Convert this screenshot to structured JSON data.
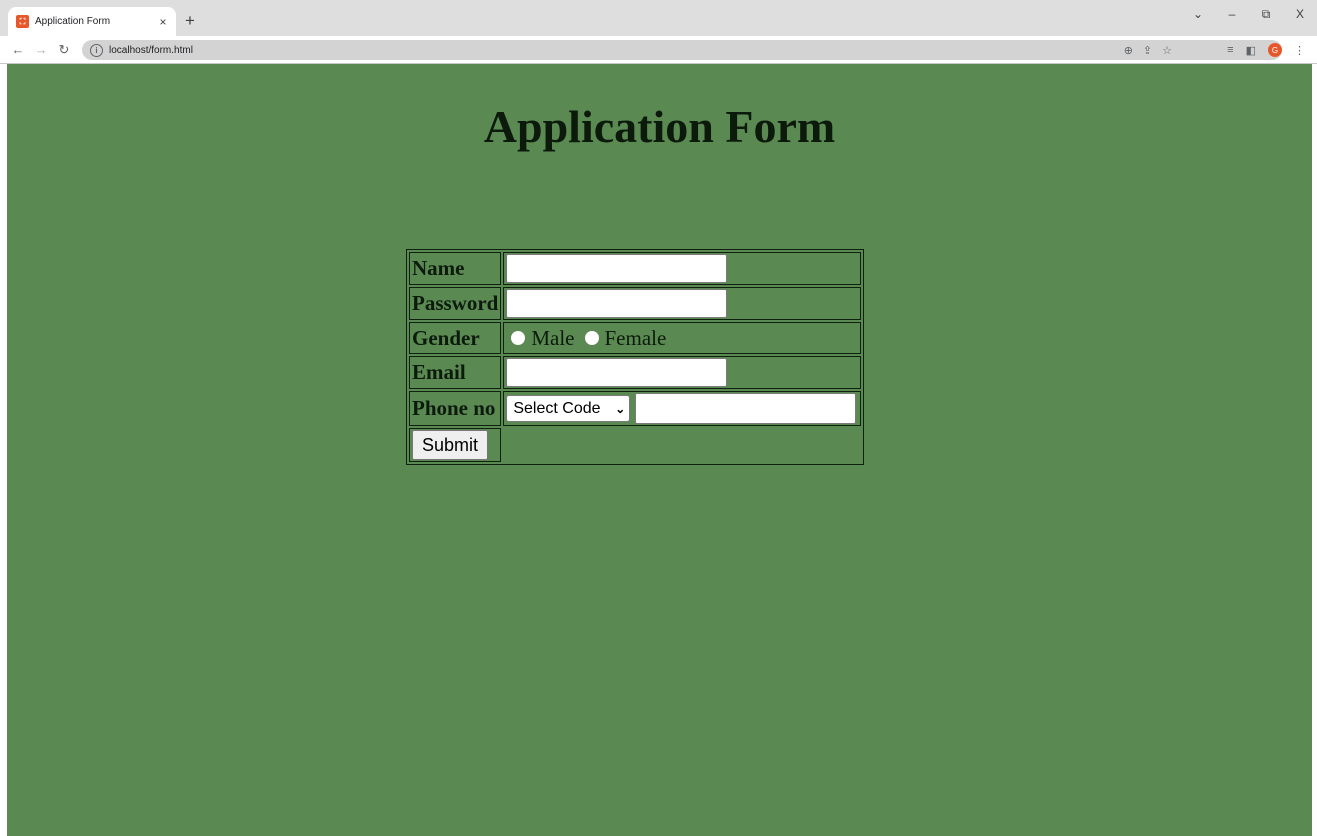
{
  "browser": {
    "tab_title": "Application Form",
    "tab_close": "×",
    "new_tab": "+",
    "url": "localhost/form.html",
    "profile_initial": "G",
    "window_controls": {
      "dropdown": "⌄",
      "minimize": "–",
      "restore": "⧉",
      "close": "X"
    }
  },
  "page": {
    "title": "Application Form",
    "background_color": "#5a8a52"
  },
  "form": {
    "name_label": "Name",
    "password_label": "Password",
    "gender_label": "Gender",
    "gender_options": [
      "Male",
      "Female"
    ],
    "email_label": "Email",
    "phone_label": "Phone no",
    "code_select_value": "Select Code",
    "submit_label": "Submit"
  }
}
